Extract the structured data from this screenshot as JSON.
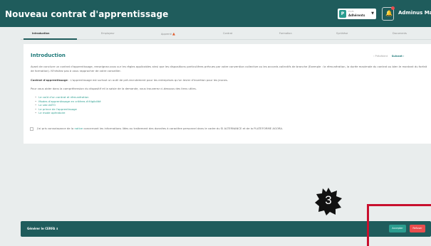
{
  "header": {
    "title": "Nouveau contrat d'apprentissage",
    "profile_label": "Profil",
    "profile_value": "Adhérents",
    "user_name": "Adminus Maxim"
  },
  "steps": [
    {
      "label": "Introduction",
      "active": true
    },
    {
      "label": "Employeur",
      "active": false
    },
    {
      "label": "Apprenti",
      "active": false,
      "warning": true
    },
    {
      "label": "Contrat",
      "active": false
    },
    {
      "label": "Formation",
      "active": false
    },
    {
      "label": "Synthèse",
      "active": false
    },
    {
      "label": "Documents",
      "active": false
    }
  ],
  "intro": {
    "title": "Introduction",
    "prev": "Précédent",
    "next": "Suivant",
    "p1": "Avant de conclure un contrat d'apprentissage, renseignez-vous sur les règles applicables ainsi que les dispositions particulières prévues par votre convention collective ou les accords collectifs de branche (Exemple : la rémunération, la durée maximale du contrat ou bien le montant du forfait de formation). N'hésitez pas à vous rapprocher de votre conseiller.",
    "p2_strong": "Contrat d'apprentissage",
    "p2_rest": " : L'apprentissage est surtout un outil de pré-recrutement pour les entreprises qu'un levier d'insertion pour les jeunes.",
    "p3": "Pour vous aider dans la compréhension du dispositif et la saisie de la demande, vous trouverez ci-dessous des liens utiles.",
    "links": [
      "Le coût d'un contrat et rémunération",
      "Modes d'apprentissage en critères d'éligibilité",
      "Le site AKTO",
      "Le prince de l'apprentissage",
      "Le mode opératoire"
    ],
    "consent_before": "J'ai pris connaissance de la ",
    "consent_link": "notice",
    "consent_after": " concernant les informations liées au traitement des données à caractère personnel dans le cadre du SI ALTERNANCE et de la PLATEFORME AGORA."
  },
  "footer": {
    "cerfa": "Générer le CERFA",
    "accept": "Accepter",
    "refuse": "Refuser"
  },
  "badge": "3",
  "colors": {
    "primary": "#1f5c5c",
    "accent": "#2a9d8f",
    "danger": "#e94e4e",
    "highlight_frame": "#c8102e",
    "background": "#e9eded"
  }
}
